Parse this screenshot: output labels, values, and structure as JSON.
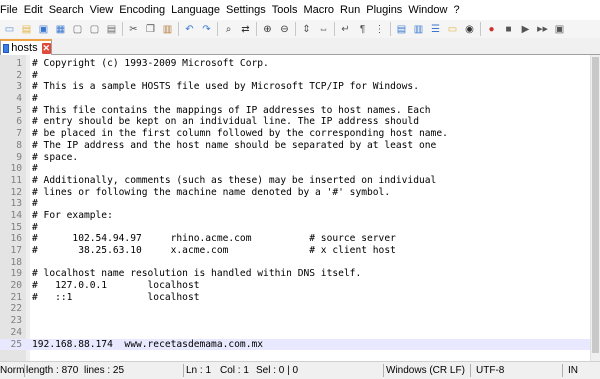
{
  "menu": [
    "File",
    "Edit",
    "Search",
    "View",
    "Encoding",
    "Language",
    "Settings",
    "Tools",
    "Macro",
    "Run",
    "Plugins",
    "Window",
    "?"
  ],
  "toolbar": {
    "buttons": [
      {
        "icon": "new-file-icon",
        "glyph": "▭",
        "color": "#5a8fd8"
      },
      {
        "icon": "open-file-icon",
        "glyph": "▤",
        "color": "#e3b341"
      },
      {
        "icon": "save-icon",
        "glyph": "▣",
        "color": "#3a78d0"
      },
      {
        "icon": "save-all-icon",
        "glyph": "▦",
        "color": "#3a78d0"
      },
      {
        "icon": "close-icon",
        "glyph": "▢",
        "color": "#6a6a6a"
      },
      {
        "icon": "close-all-icon",
        "glyph": "▢",
        "color": "#6a6a6a"
      },
      {
        "icon": "print-icon",
        "glyph": "▤",
        "color": "#6a6a6a"
      },
      {
        "sep": true
      },
      {
        "icon": "cut-icon",
        "glyph": "✂",
        "color": "#555"
      },
      {
        "icon": "copy-icon",
        "glyph": "❐",
        "color": "#555"
      },
      {
        "icon": "paste-icon",
        "glyph": "▥",
        "color": "#b07a3a"
      },
      {
        "sep": true
      },
      {
        "icon": "undo-icon",
        "glyph": "↶",
        "color": "#3a78d0"
      },
      {
        "icon": "redo-icon",
        "glyph": "↷",
        "color": "#3a78d0"
      },
      {
        "sep": true
      },
      {
        "icon": "find-icon",
        "glyph": "⌕",
        "color": "#333"
      },
      {
        "icon": "replace-icon",
        "glyph": "⇄",
        "color": "#333"
      },
      {
        "sep": true
      },
      {
        "icon": "zoom-in-icon",
        "glyph": "⊕",
        "color": "#333"
      },
      {
        "icon": "zoom-out-icon",
        "glyph": "⊖",
        "color": "#333"
      },
      {
        "sep": true
      },
      {
        "icon": "sync-vertical-icon",
        "glyph": "⇕",
        "color": "#555"
      },
      {
        "icon": "sync-horizontal-icon",
        "glyph": "⇔",
        "color": "#555"
      },
      {
        "sep": true
      },
      {
        "icon": "word-wrap-icon",
        "glyph": "↵",
        "color": "#555"
      },
      {
        "icon": "show-all-chars-icon",
        "glyph": "¶",
        "color": "#555"
      },
      {
        "icon": "indent-guide-icon",
        "glyph": "⋮",
        "color": "#555"
      },
      {
        "sep": true
      },
      {
        "icon": "udl-icon",
        "glyph": "▤",
        "color": "#3a78d0"
      },
      {
        "icon": "doc-map-icon",
        "glyph": "▥",
        "color": "#3a78d0"
      },
      {
        "icon": "function-list-icon",
        "glyph": "☰",
        "color": "#3a78d0"
      },
      {
        "icon": "folder-workspace-icon",
        "glyph": "▭",
        "color": "#e3b341"
      },
      {
        "icon": "monitoring-icon",
        "glyph": "◉",
        "color": "#333"
      },
      {
        "sep": true
      },
      {
        "icon": "record-macro-icon",
        "glyph": "●",
        "color": "#d03030"
      },
      {
        "icon": "stop-record-icon",
        "glyph": "■",
        "color": "#555"
      },
      {
        "icon": "play-macro-icon",
        "glyph": "▶",
        "color": "#555"
      },
      {
        "icon": "run-macro-multiple-icon",
        "glyph": "▶▶",
        "color": "#555"
      },
      {
        "icon": "save-macro-icon",
        "glyph": "▣",
        "color": "#555"
      }
    ]
  },
  "tab": {
    "label": "hosts"
  },
  "editor": {
    "current_line": 25,
    "lines": [
      {
        "n": "1",
        "text": "# Copyright (c) 1993-2009 Microsoft Corp."
      },
      {
        "n": "2",
        "text": "#"
      },
      {
        "n": "3",
        "text": "# This is a sample HOSTS file used by Microsoft TCP/IP for Windows."
      },
      {
        "n": "4",
        "text": "#"
      },
      {
        "n": "5",
        "text": "# This file contains the mappings of IP addresses to host names. Each"
      },
      {
        "n": "6",
        "text": "# entry should be kept on an individual line. The IP address should"
      },
      {
        "n": "7",
        "text": "# be placed in the first column followed by the corresponding host name."
      },
      {
        "n": "8",
        "text": "# The IP address and the host name should be separated by at least one"
      },
      {
        "n": "9",
        "text": "# space."
      },
      {
        "n": "10",
        "text": "#"
      },
      {
        "n": "11",
        "text": "# Additionally, comments (such as these) may be inserted on individual"
      },
      {
        "n": "12",
        "text": "# lines or following the machine name denoted by a '#' symbol."
      },
      {
        "n": "13",
        "text": "#"
      },
      {
        "n": "14",
        "text": "# For example:"
      },
      {
        "n": "15",
        "text": "#"
      },
      {
        "n": "16",
        "text": "#      102.54.94.97     rhino.acme.com          # source server"
      },
      {
        "n": "17",
        "text": "#       38.25.63.10     x.acme.com              # x client host"
      },
      {
        "n": "18",
        "text": ""
      },
      {
        "n": "19",
        "text": "# localhost name resolution is handled within DNS itself."
      },
      {
        "n": "20",
        "text": "#   127.0.0.1       localhost"
      },
      {
        "n": "21",
        "text": "#   ::1             localhost"
      },
      {
        "n": "22",
        "text": ""
      },
      {
        "n": "23",
        "text": ""
      },
      {
        "n": "24",
        "text": ""
      },
      {
        "n": "25",
        "text": "192.168.88.174  www.recetasdemama.com.mx"
      }
    ]
  },
  "status": {
    "language": "Normal",
    "length": "length : 870",
    "lines": "lines : 25",
    "ln": "Ln : 1",
    "col": "Col : 1",
    "sel": "Sel : 0 | 0",
    "eol": "Windows (CR LF)",
    "encoding": "UTF-8",
    "mode": "IN"
  }
}
